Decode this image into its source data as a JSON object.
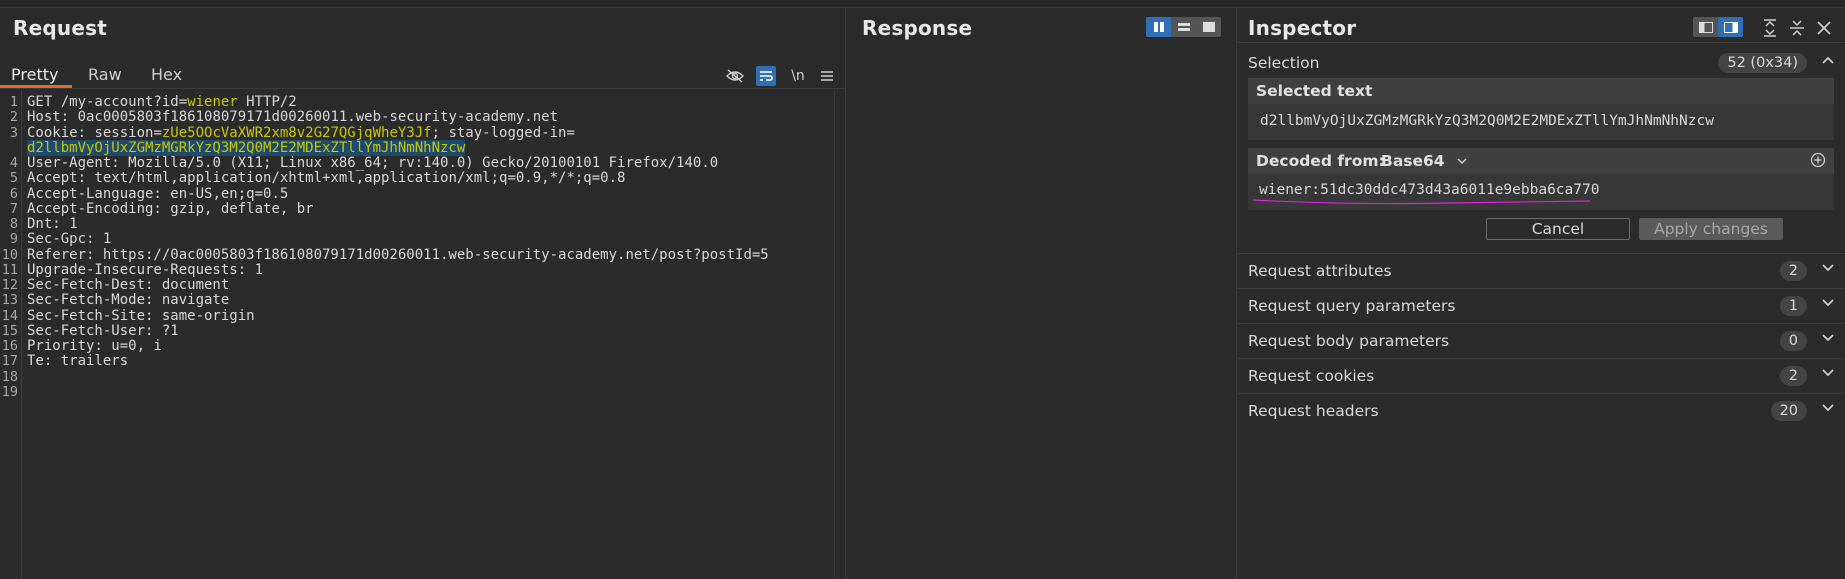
{
  "request": {
    "title": "Request",
    "tabs": [
      "Pretty",
      "Raw",
      "Hex"
    ],
    "icons": [
      "eye-off-icon",
      "wrap-icon",
      "newline-icon",
      "menu-icon"
    ],
    "newline_glyph": "\\n",
    "lines": [
      {
        "n": "1",
        "parts": [
          {
            "t": "GET /my-account?id=",
            "c": "hval"
          },
          {
            "t": "wiener",
            "c": "pval"
          },
          {
            "t": " HTTP/2",
            "c": "hval"
          }
        ]
      },
      {
        "n": "2",
        "parts": [
          {
            "t": "Host: ",
            "c": "hname"
          },
          {
            "t": "0ac0005803f186108079171d00260011.web-security-academy.net",
            "c": "hval"
          }
        ]
      },
      {
        "n": "3",
        "parts": [
          {
            "t": "Cookie: ",
            "c": "hname"
          },
          {
            "t": "session=",
            "c": "hval"
          },
          {
            "t": "zUe5OOcVaXWR2xm8v2G27QGjqWheY3Jf",
            "c": "pval"
          },
          {
            "t": "; stay-logged-in=",
            "c": "hval"
          }
        ]
      },
      {
        "n": "",
        "parts": [
          {
            "t": "d2llbmVyOjUxZGMzMGRkYzQ3M2Q0M2E2MDExZTllYmJhNmNhNzcw",
            "c": "sel"
          }
        ]
      },
      {
        "n": "4",
        "parts": [
          {
            "t": "User-Agent: ",
            "c": "hname"
          },
          {
            "t": "Mozilla/5.0 (X11; Linux x86_64; rv:140.0) Gecko/20100101 Firefox/140.0",
            "c": "hval"
          }
        ]
      },
      {
        "n": "5",
        "parts": [
          {
            "t": "Accept: ",
            "c": "hname"
          },
          {
            "t": "text/html,application/xhtml+xml,application/xml;q=0.9,*/*;q=0.8",
            "c": "hval"
          }
        ]
      },
      {
        "n": "6",
        "parts": [
          {
            "t": "Accept-Language: ",
            "c": "hname"
          },
          {
            "t": "en-US,en;q=0.5",
            "c": "hval"
          }
        ]
      },
      {
        "n": "7",
        "parts": [
          {
            "t": "Accept-Encoding: ",
            "c": "hname"
          },
          {
            "t": "gzip, deflate, br",
            "c": "hval"
          }
        ]
      },
      {
        "n": "8",
        "parts": [
          {
            "t": "Dnt: ",
            "c": "hname"
          },
          {
            "t": "1",
            "c": "hval"
          }
        ]
      },
      {
        "n": "9",
        "parts": [
          {
            "t": "Sec-Gpc: ",
            "c": "hname"
          },
          {
            "t": "1",
            "c": "hval"
          }
        ]
      },
      {
        "n": "10",
        "parts": [
          {
            "t": "Referer: ",
            "c": "hname"
          },
          {
            "t": "https://0ac0005803f186108079171d00260011.web-security-academy.net/post?postId=5",
            "c": "hval"
          }
        ]
      },
      {
        "n": "11",
        "parts": [
          {
            "t": "Upgrade-Insecure-Requests: ",
            "c": "hname"
          },
          {
            "t": "1",
            "c": "hval"
          }
        ]
      },
      {
        "n": "12",
        "parts": [
          {
            "t": "Sec-Fetch-Dest: ",
            "c": "hname"
          },
          {
            "t": "document",
            "c": "hval"
          }
        ]
      },
      {
        "n": "13",
        "parts": [
          {
            "t": "Sec-Fetch-Mode: ",
            "c": "hname"
          },
          {
            "t": "navigate",
            "c": "hval"
          }
        ]
      },
      {
        "n": "14",
        "parts": [
          {
            "t": "Sec-Fetch-Site: ",
            "c": "hname"
          },
          {
            "t": "same-origin",
            "c": "hval"
          }
        ]
      },
      {
        "n": "15",
        "parts": [
          {
            "t": "Sec-Fetch-User: ",
            "c": "hname"
          },
          {
            "t": "?1",
            "c": "hval"
          }
        ]
      },
      {
        "n": "16",
        "parts": [
          {
            "t": "Priority: ",
            "c": "hname"
          },
          {
            "t": "u=0, i",
            "c": "hval"
          }
        ]
      },
      {
        "n": "17",
        "parts": [
          {
            "t": "Te: ",
            "c": "hname"
          },
          {
            "t": "trailers",
            "c": "hval"
          }
        ]
      },
      {
        "n": "18",
        "parts": []
      },
      {
        "n": "19",
        "parts": []
      }
    ]
  },
  "response": {
    "title": "Response",
    "view_modes": [
      "split-columns-icon",
      "split-rows-icon",
      "single-view-icon"
    ]
  },
  "inspector": {
    "title": "Inspector",
    "toolbar_icons": [
      "layout-left-icon",
      "layout-right-icon",
      "expand-icon",
      "collapse-icon",
      "close-icon"
    ],
    "selection": {
      "label": "Selection",
      "badge": "52 (0x34)"
    },
    "selected_text": {
      "label": "Selected text",
      "value": "d2llbmVyOjUxZGMzMGRkYzQ3M2Q0M2E2MDExZTllYmJhNmNhNzcw"
    },
    "decoded": {
      "label": "Decoded from:",
      "encoding": "Base64",
      "value": "wiener:51dc30ddc473d43a6011e9ebba6ca770",
      "underline_color": "#e020e0"
    },
    "buttons": {
      "cancel": "Cancel",
      "apply": "Apply changes"
    },
    "sections": [
      {
        "label": "Request attributes",
        "count": "2"
      },
      {
        "label": "Request query parameters",
        "count": "1"
      },
      {
        "label": "Request body parameters",
        "count": "0"
      },
      {
        "label": "Request cookies",
        "count": "2"
      },
      {
        "label": "Request headers",
        "count": "20"
      }
    ]
  },
  "colors": {
    "accent": "#e36a2a",
    "active_blue": "#2f6fb5",
    "param_yellow": "#c8c800",
    "selection_bg": "#1e4a6e"
  }
}
